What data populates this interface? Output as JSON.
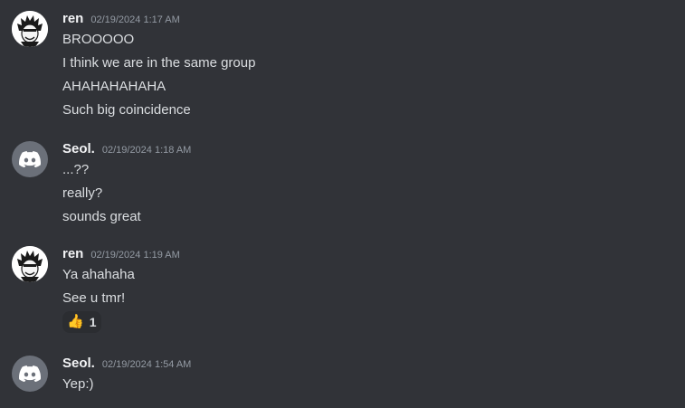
{
  "messages": [
    {
      "username": "ren",
      "timestamp": "02/19/2024 1:17 AM",
      "avatar_icon": "anime-character-avatar",
      "lines": [
        "BROOOOO",
        "I think we are in the same group",
        "AHAHAHAHAHA",
        "Such big coincidence"
      ]
    },
    {
      "username": "Seol.",
      "timestamp": "02/19/2024 1:18 AM",
      "avatar_icon": "discord-default-avatar",
      "lines": [
        "...??",
        "really?",
        "sounds great"
      ]
    },
    {
      "username": "ren",
      "timestamp": "02/19/2024 1:19 AM",
      "avatar_icon": "anime-character-avatar",
      "lines": [
        "Ya ahahaha",
        "See u tmr!"
      ],
      "reaction": {
        "emoji": "👍",
        "count": "1"
      }
    },
    {
      "username": "Seol.",
      "timestamp": "02/19/2024 1:54 AM",
      "avatar_icon": "discord-default-avatar",
      "lines": [
        "Yep:)"
      ]
    }
  ],
  "colors": {
    "background": "#313338",
    "username": "#f2f3f5",
    "timestamp": "#949ba4",
    "text": "#dbdee1",
    "discord_avatar_bg": "#6b7079"
  }
}
